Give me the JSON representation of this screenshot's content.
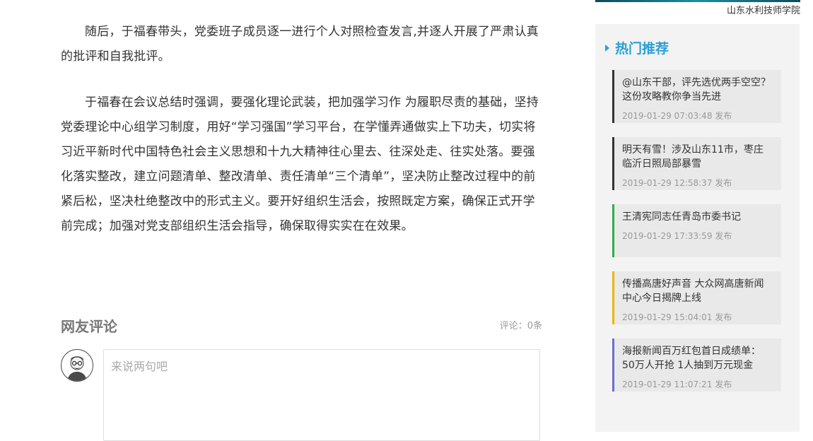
{
  "article": {
    "paragraphs": [
      "随后，于福春带头，党委班子成员逐一进行个人对照检查发言,并逐人开展了严肃认真的批评和自我批评。",
      "于福春在会议总结时强调，要强化理论武装，把加强学习作 为履职尽责的基础，坚持党委理论中心组学习制度，用好“学习强国”学习平台，在学懂弄通做实上下功夫，切实将习近平新时代中国特色社会主义思想和十九大精神往心里去、往深处走、往实处落。要强化落实整改，建立问题清单、整改清单、责任清单“三个清单”，坚决防止整改过程中的前紧后松，坚决杜绝整改中的形式主义。要开好组织生活会，按照既定方案，确保正式开学前完成；加强对党支部组织生活会指导，确保取得实实在在效果。"
    ]
  },
  "comments": {
    "title": "网友评论",
    "count_label": "评论：",
    "count": "0",
    "count_unit": "条",
    "input_placeholder": "来说两句吧"
  },
  "banner": {
    "caption": "山东水利技师学院"
  },
  "sidebar": {
    "title": "热门推荐",
    "items": [
      {
        "title": "@山东干部，评先选优两手空空？这份攻略教你争当先进",
        "time": "2019-01-29 07:03:48 发布",
        "accent": "#333333"
      },
      {
        "title": "明天有雪！涉及山东11市，枣庄临沂日照局部暴雪",
        "time": "2019-01-29 12:58:37 发布",
        "accent": "#333333"
      },
      {
        "title": "王清宪同志任青岛市委书记",
        "time": "2019-01-29 17:33:59 发布",
        "accent": "#2fae4a"
      },
      {
        "title": "传播高唐好声音 大众网高唐新闻中心今日揭牌上线",
        "time": "2019-01-29 15:04:01 发布",
        "accent": "#f0b400"
      },
      {
        "title": "海报新闻百万红包首日成绩单：50万人开抢 1人抽到万元现金",
        "time": "2019-01-29 11:07:21 发布",
        "accent": "#6a6fd0"
      }
    ]
  }
}
